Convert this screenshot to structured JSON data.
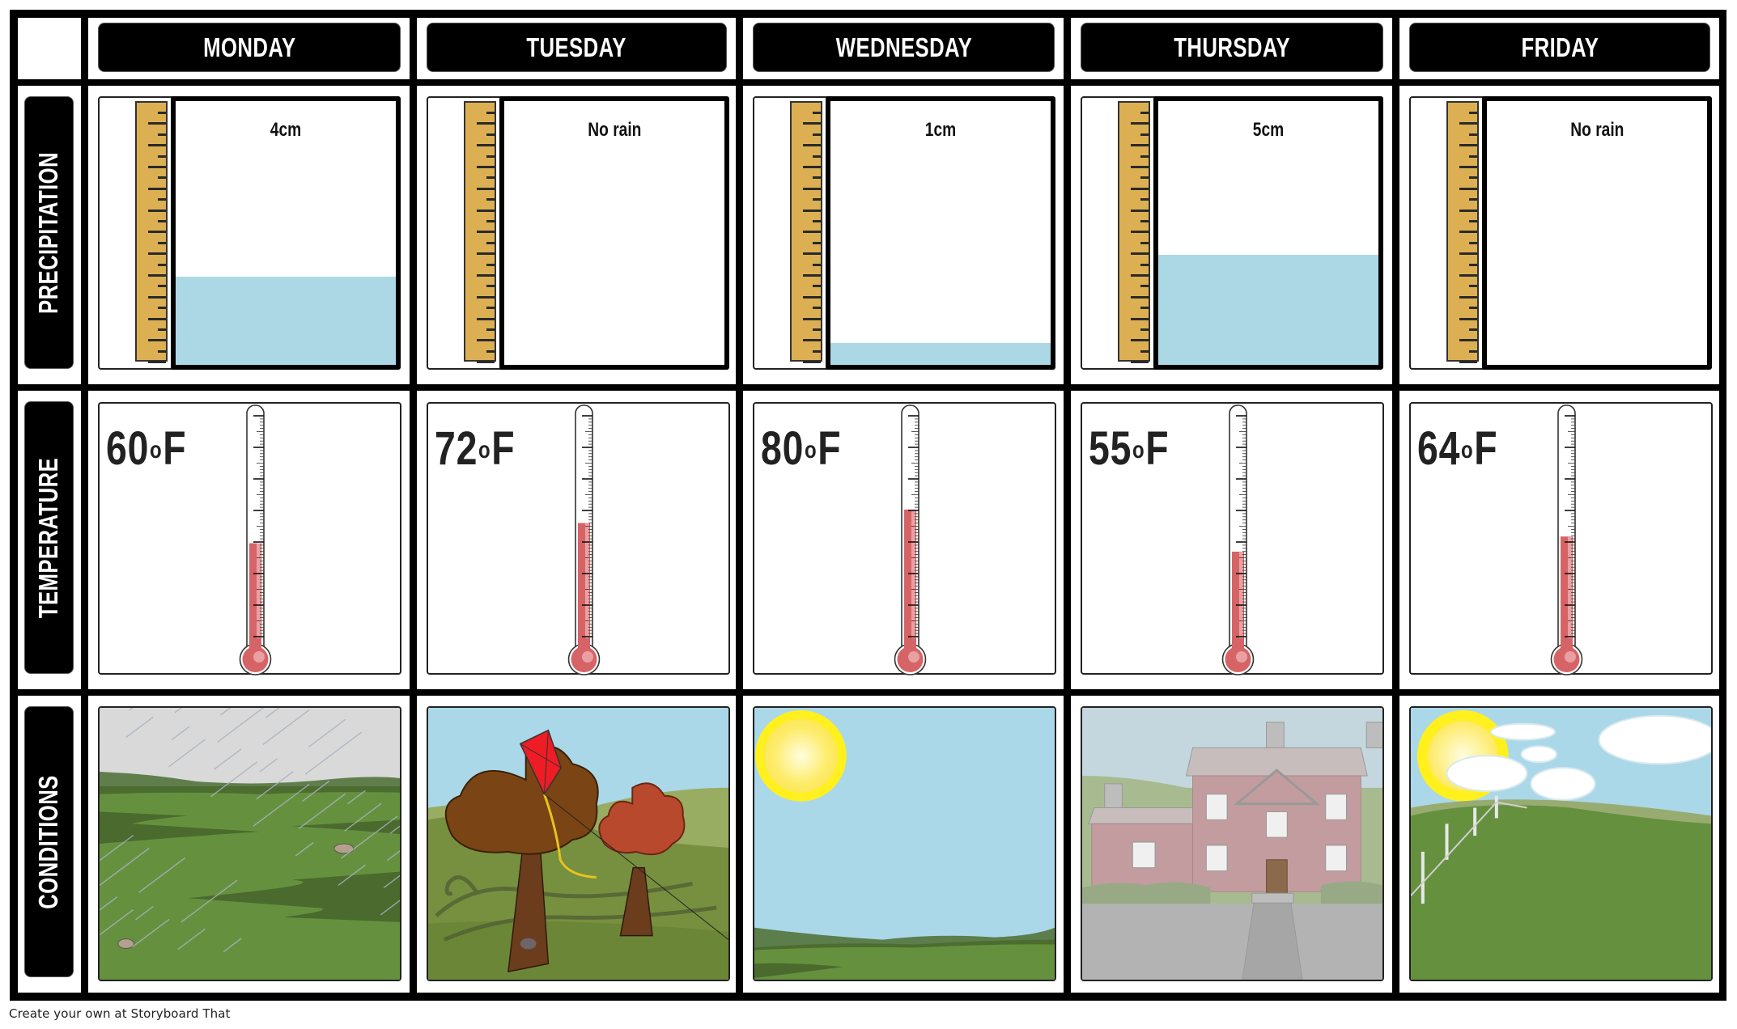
{
  "board": {
    "columns": [
      "MONDAY",
      "TUESDAY",
      "WEDNESDAY",
      "THURSDAY",
      "FRIDAY"
    ],
    "rows": [
      "PRECIPITATION",
      "TEMPERATURE",
      "CONDITIONS"
    ]
  },
  "precipitation": {
    "gauge_scale_max_cm": 12,
    "days": [
      {
        "day": "MONDAY",
        "label": "4cm",
        "amount_cm": 4
      },
      {
        "day": "TUESDAY",
        "label": "No rain",
        "amount_cm": 0
      },
      {
        "day": "WEDNESDAY",
        "label": "1cm",
        "amount_cm": 1
      },
      {
        "day": "THURSDAY",
        "label": "5cm",
        "amount_cm": 5
      },
      {
        "day": "FRIDAY",
        "label": "No rain",
        "amount_cm": 0
      }
    ]
  },
  "temperature": {
    "unit_prefix": "o",
    "unit_suffix": "F",
    "thermometer_scale_min_f": -9,
    "thermometer_scale_max_f": 142,
    "days": [
      {
        "day": "MONDAY",
        "value": "60",
        "value_f": 60
      },
      {
        "day": "TUESDAY",
        "value": "72",
        "value_f": 72
      },
      {
        "day": "WEDNESDAY",
        "value": "80",
        "value_f": 80
      },
      {
        "day": "THURSDAY",
        "value": "55",
        "value_f": 55
      },
      {
        "day": "FRIDAY",
        "value": "64",
        "value_f": 64
      }
    ]
  },
  "conditions": {
    "days": [
      {
        "day": "MONDAY",
        "scene": "rainy-field"
      },
      {
        "day": "TUESDAY",
        "scene": "windy-trees-with-kite"
      },
      {
        "day": "WEDNESDAY",
        "scene": "sunny-clear-sky"
      },
      {
        "day": "THURSDAY",
        "scene": "foggy-brick-house"
      },
      {
        "day": "FRIDAY",
        "scene": "partly-cloudy-hill-with-fence"
      }
    ]
  },
  "colors": {
    "ruler": "#dcb052",
    "water": "#acd8e6",
    "mercury": "#d66466",
    "grass": "#65913e",
    "sky": "#abd8e8",
    "sun": "#fff01e"
  },
  "footer": {
    "text": "Create your own at Storyboard That"
  }
}
